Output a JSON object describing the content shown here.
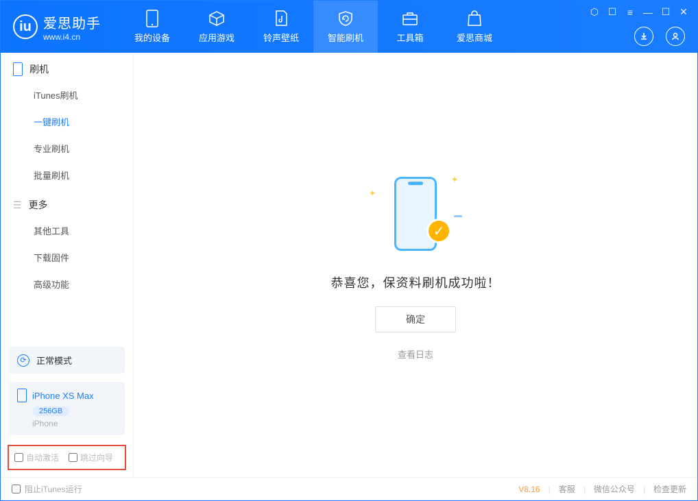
{
  "app": {
    "name": "爱思助手",
    "url": "www.i4.cn"
  },
  "tabs": {
    "device": "我的设备",
    "apps": "应用游戏",
    "ringtone": "铃声壁纸",
    "flash": "智能刷机",
    "toolbox": "工具箱",
    "store": "爱思商城"
  },
  "sidebar": {
    "group_flash": "刷机",
    "items_flash": {
      "itunes": "iTunes刷机",
      "oneclick": "一键刷机",
      "pro": "专业刷机",
      "batch": "批量刷机"
    },
    "group_more": "更多",
    "items_more": {
      "other": "其他工具",
      "firmware": "下载固件",
      "advanced": "高级功能"
    }
  },
  "mode": {
    "label": "正常模式"
  },
  "device": {
    "name": "iPhone XS Max",
    "storage": "256GB",
    "type": "iPhone"
  },
  "checkboxes": {
    "auto_activate": "自动激活",
    "skip_guide": "跳过向导"
  },
  "main": {
    "success_text": "恭喜您，保资料刷机成功啦！",
    "ok": "确定",
    "log": "查看日志"
  },
  "status": {
    "block_itunes": "阻止iTunes运行",
    "version": "V8.16",
    "support": "客服",
    "wechat": "微信公众号",
    "update": "检查更新"
  }
}
